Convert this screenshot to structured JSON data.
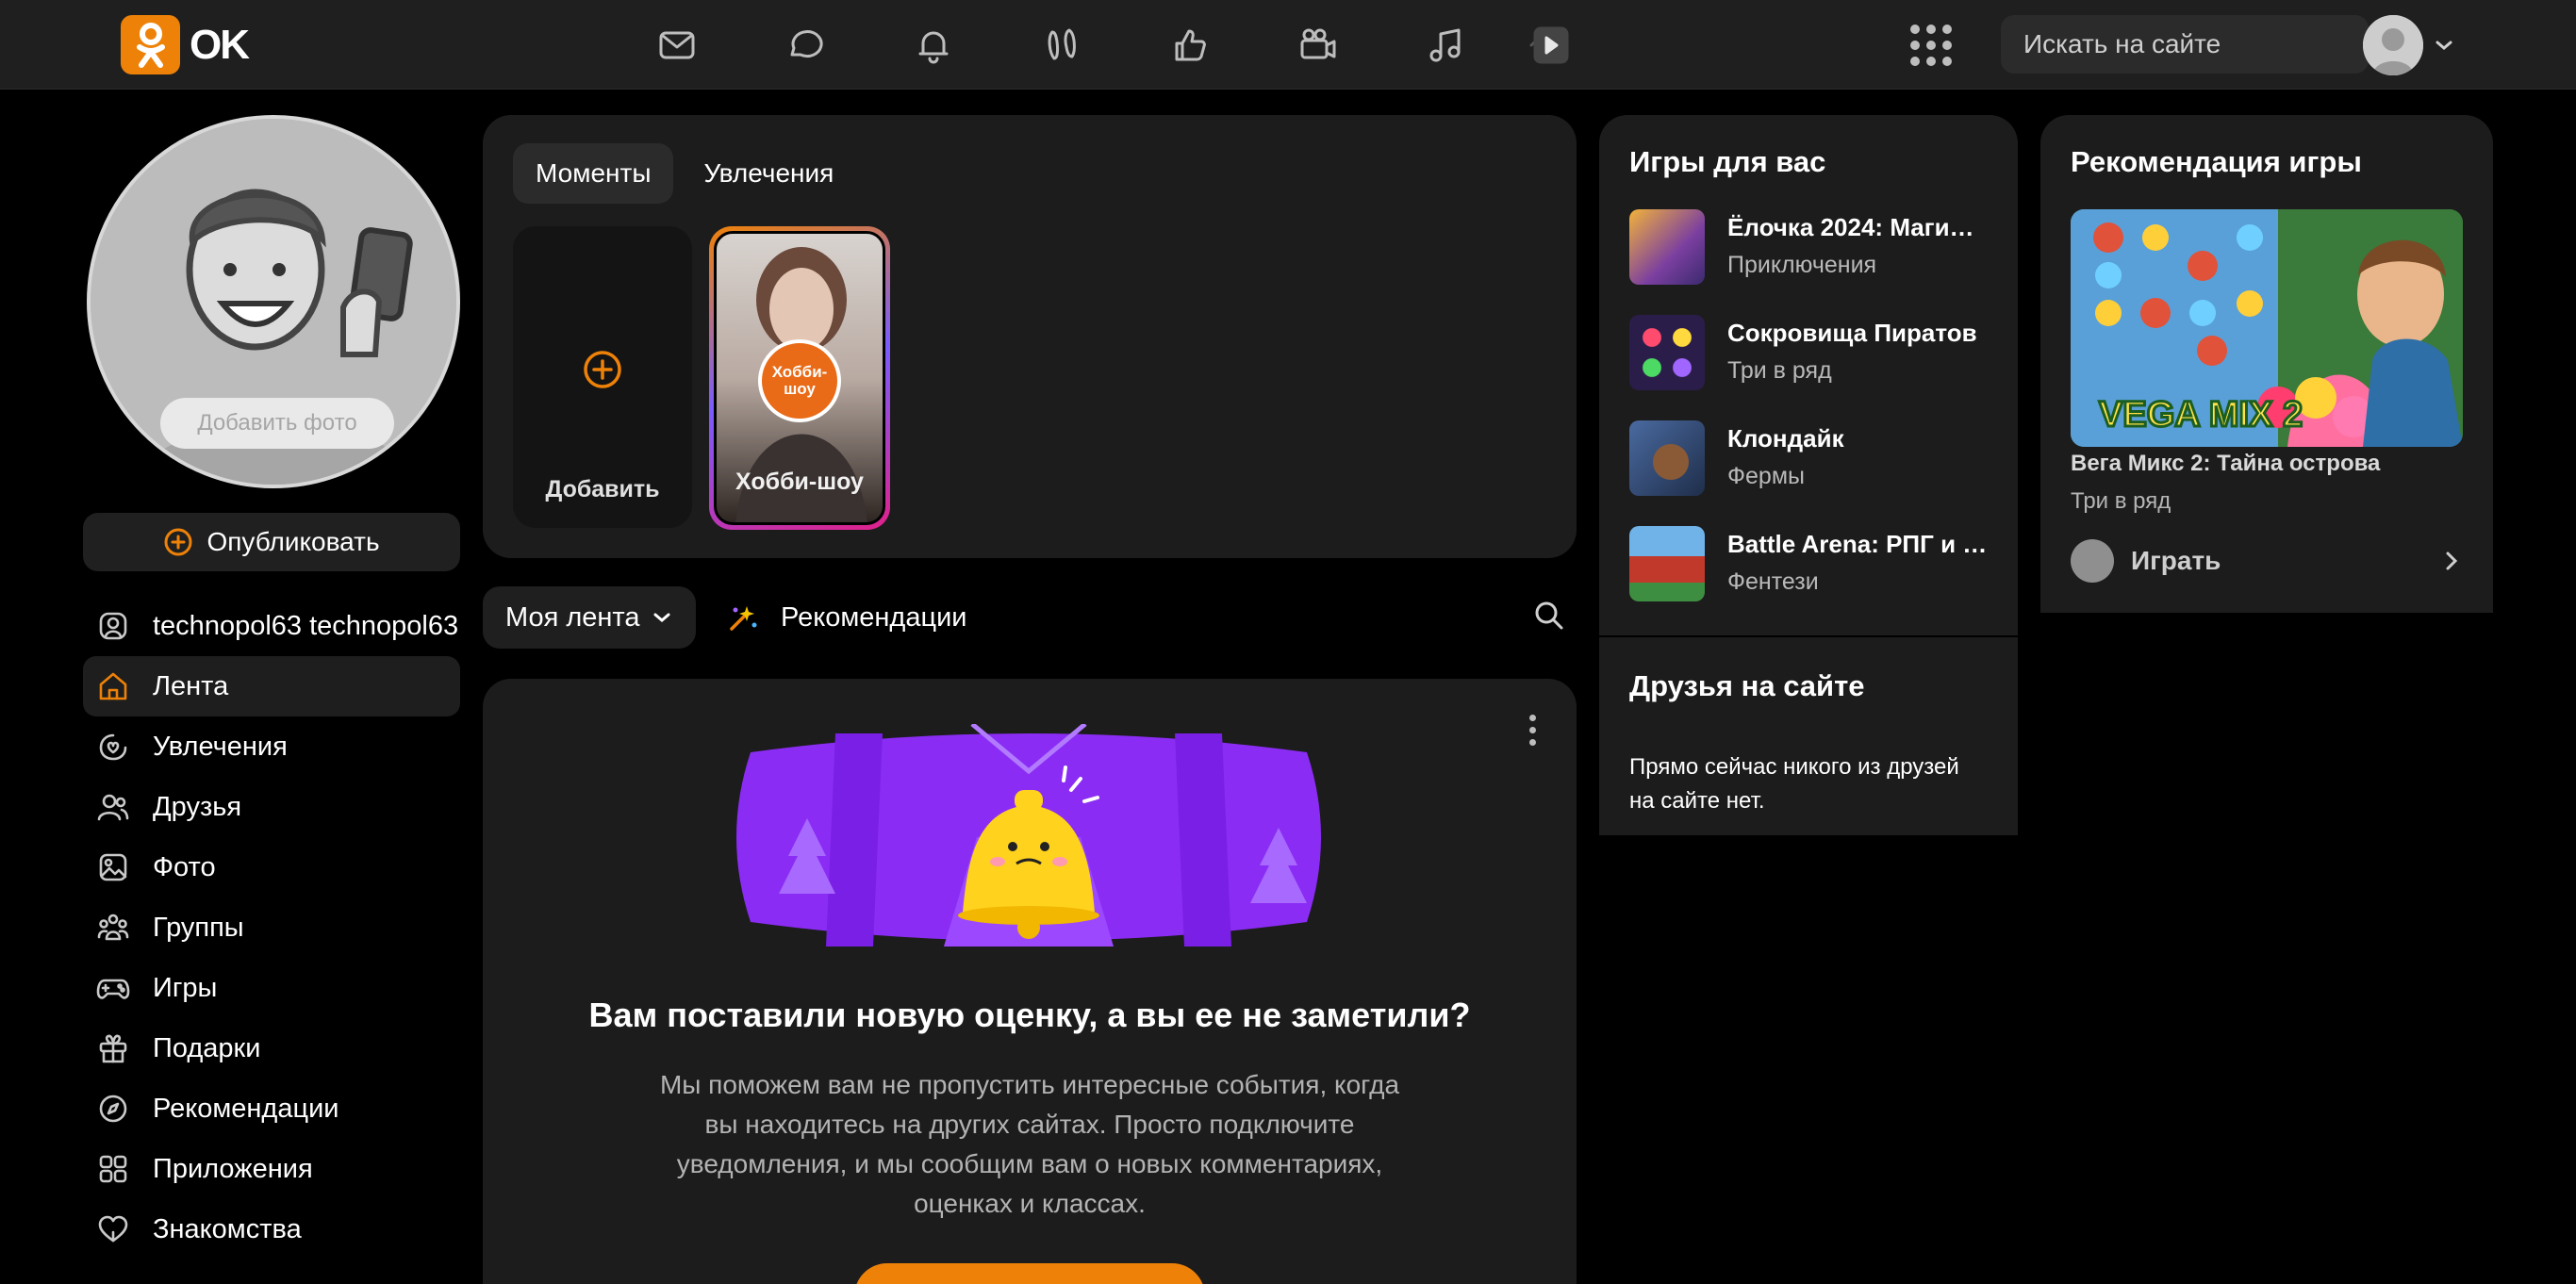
{
  "brand": {
    "name": "OK",
    "color": "#ee8208"
  },
  "topbar": {
    "nav_icons": [
      "messages-icon",
      "discussions-icon",
      "notifications-icon",
      "guests-icon",
      "likes-icon",
      "video-icon",
      "music-icon",
      "play-icon"
    ],
    "search_placeholder": "Искать на сайте"
  },
  "profile": {
    "add_photo": "Добавить фото",
    "publish": "Опубликовать"
  },
  "sidebar": {
    "items": [
      {
        "label": "technopol63 technopol63",
        "icon": "user-icon"
      },
      {
        "label": "Лента",
        "icon": "home-icon",
        "active": true
      },
      {
        "label": "Увлечения",
        "icon": "hobby-icon"
      },
      {
        "label": "Друзья",
        "icon": "friends-icon"
      },
      {
        "label": "Фото",
        "icon": "photo-icon"
      },
      {
        "label": "Группы",
        "icon": "groups-icon"
      },
      {
        "label": "Игры",
        "icon": "gamepad-icon"
      },
      {
        "label": "Подарки",
        "icon": "gift-icon"
      },
      {
        "label": "Рекомендации",
        "icon": "compass-icon"
      },
      {
        "label": "Приложения",
        "icon": "apps-icon"
      },
      {
        "label": "Знакомства",
        "icon": "dating-icon"
      }
    ]
  },
  "moments": {
    "tabs": [
      "Моменты",
      "Увлечения"
    ],
    "add_label": "Добавить",
    "story": {
      "badge": "Хобби-шоу",
      "label": "Хобби-шоу"
    }
  },
  "feed": {
    "selector": "Моя лента",
    "recommendations": "Рекомендации"
  },
  "notification": {
    "title": "Вам поставили новую оценку, а вы ее не заметили?",
    "text": "Мы поможем вам не пропустить интересные события, когда вы находитесь на других сайтах. Просто подключите уведомления, и мы сообщим вам о новых комментариях, оценках и классах."
  },
  "games": {
    "title": "Игры для вас",
    "items": [
      {
        "name": "Ёлочка 2024: Маги…",
        "genre": "Приключения"
      },
      {
        "name": "Сокровища Пиратов",
        "genre": "Три в ряд"
      },
      {
        "name": "Клондайк",
        "genre": "Фермы"
      },
      {
        "name": "Battle Arena: РПГ и …",
        "genre": "Фентези"
      }
    ]
  },
  "friends": {
    "title": "Друзья на сайте",
    "text": "Прямо сейчас никого из друзей на сайте нет."
  },
  "recommended_game": {
    "title": "Рекомендация игры",
    "name": "Вега Микс 2: Тайна острова",
    "genre": "Три в ряд",
    "play": "Играть"
  }
}
